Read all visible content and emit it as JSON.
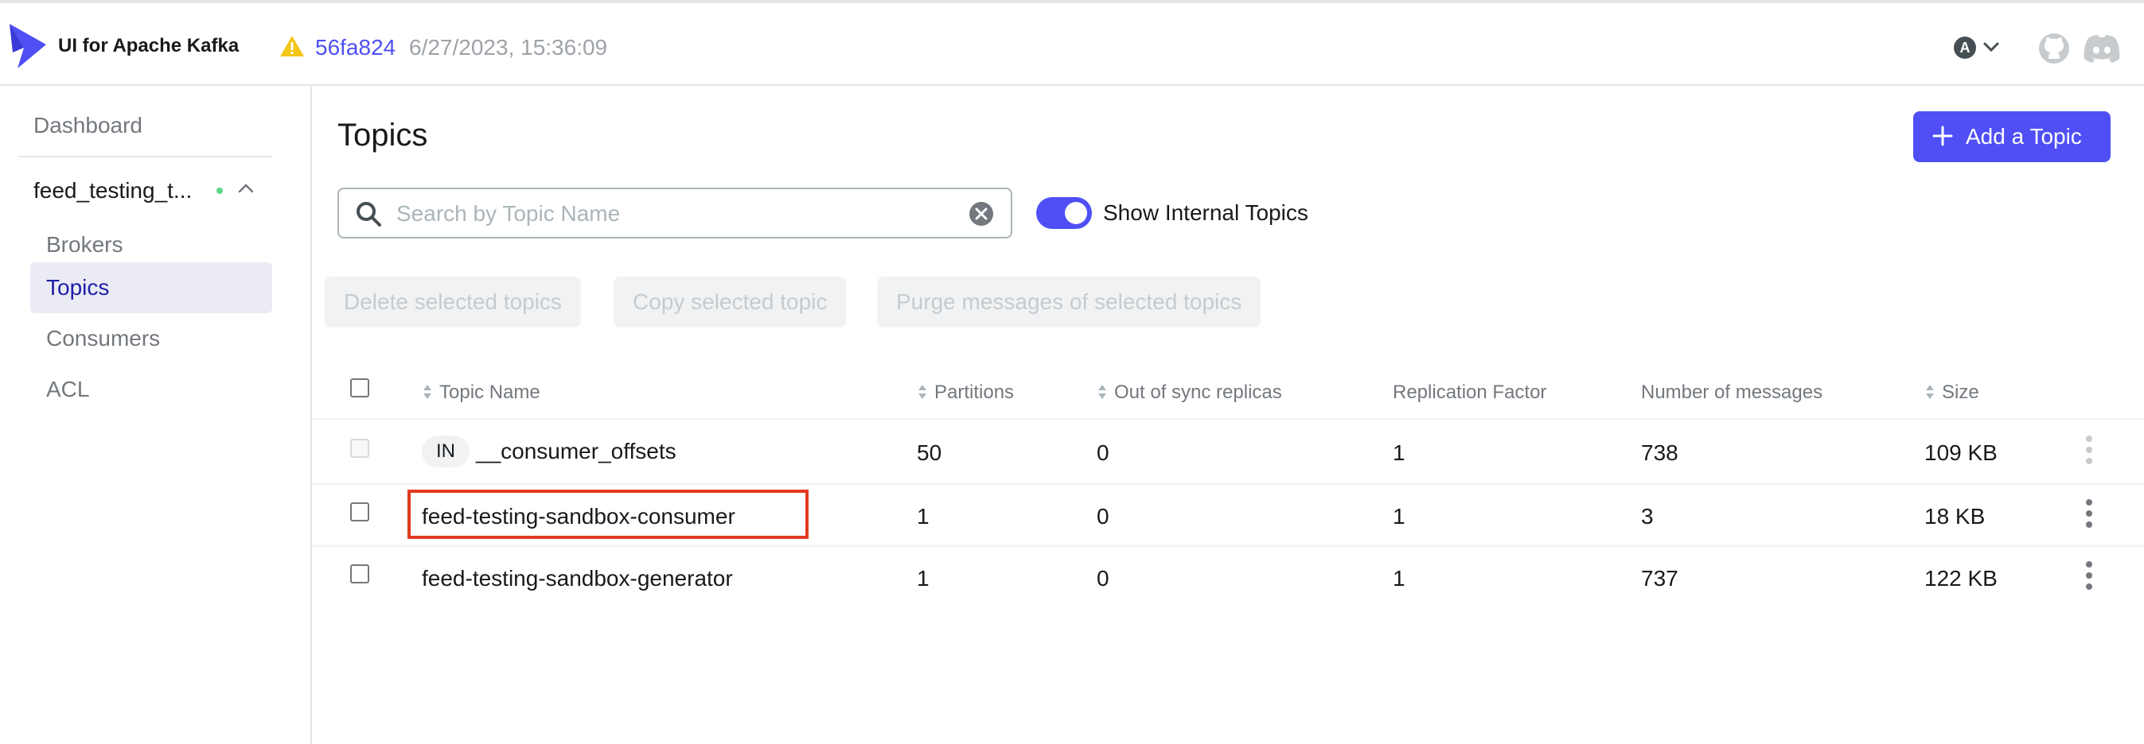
{
  "app": {
    "title": "UI for Apache Kafka",
    "commit": "56fa824",
    "build_date": "6/27/2023, 15:36:09",
    "user_initial": "A",
    "icons": {
      "logo": "kafka-ui-logo",
      "warning": "warning-triangle-icon",
      "github": "github-icon",
      "discord": "discord-icon"
    },
    "colors": {
      "accent": "#4f4ff5",
      "warning": "#f5c518",
      "status_ok": "#5cd685",
      "highlight": "#e33a1f"
    }
  },
  "sidebar": {
    "dashboard_label": "Dashboard",
    "cluster_name": "feed_testing_t...",
    "items": [
      {
        "label": "Brokers",
        "active": false
      },
      {
        "label": "Topics",
        "active": true
      },
      {
        "label": "Consumers",
        "active": false
      },
      {
        "label": "ACL",
        "active": false
      }
    ]
  },
  "main": {
    "title": "Topics",
    "add_button_label": "Add a Topic",
    "search": {
      "placeholder": "Search by Topic Name",
      "value": ""
    },
    "show_internal": {
      "label": "Show Internal Topics",
      "enabled": true
    },
    "bulk_actions": [
      "Delete selected topics",
      "Copy selected topic",
      "Purge messages of selected topics"
    ],
    "table": {
      "columns": [
        "Topic Name",
        "Partitions",
        "Out of sync replicas",
        "Replication Factor",
        "Number of messages",
        "Size"
      ],
      "rows": [
        {
          "internal_badge": "IN",
          "name": "__consumer_offsets",
          "partitions": "50",
          "out_of_sync": "0",
          "replication": "1",
          "messages": "738",
          "size": "109 KB"
        },
        {
          "internal_badge": "",
          "name": "feed-testing-sandbox-consumer",
          "partitions": "1",
          "out_of_sync": "0",
          "replication": "1",
          "messages": "3",
          "size": "18 KB"
        },
        {
          "internal_badge": "",
          "name": "feed-testing-sandbox-generator",
          "partitions": "1",
          "out_of_sync": "0",
          "replication": "1",
          "messages": "737",
          "size": "122 KB"
        }
      ]
    }
  }
}
